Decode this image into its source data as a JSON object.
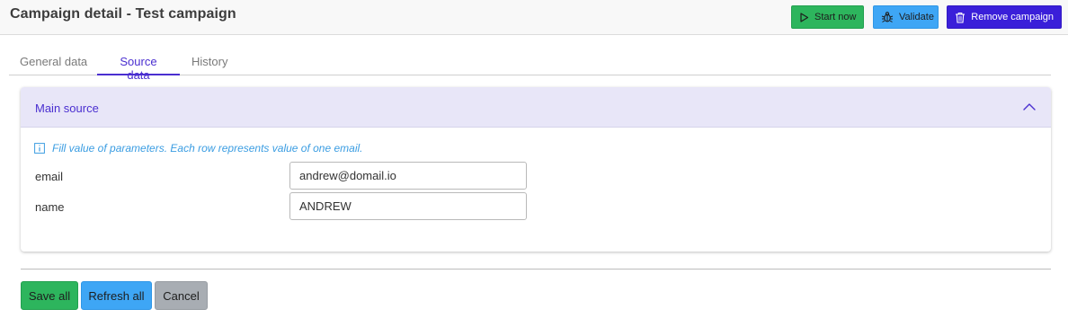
{
  "header": {
    "title": "Campaign detail - Test campaign",
    "buttons": {
      "start_label": "Start now",
      "validate_label": "Validate",
      "remove_label": "Remove campaign"
    }
  },
  "tabs": [
    {
      "label": "General data",
      "active": false
    },
    {
      "label": "Source data",
      "active": true
    },
    {
      "label": "History",
      "active": false
    }
  ],
  "card": {
    "title": "Main source",
    "expanded": true,
    "info_text": "Fill value of parameters. Each row represents value of one email.",
    "rows": [
      {
        "label": "email",
        "value": "andrew@domail.io"
      },
      {
        "label": "name",
        "value": "ANDREW"
      }
    ]
  },
  "footer": {
    "save_label": "Save all",
    "refresh_label": "Refresh all",
    "cancel_label": "Cancel"
  },
  "colors": {
    "primary": "#3a1fd9",
    "success": "#2db55d",
    "info": "#3ea6f5",
    "secondary": "#a8adb3",
    "card_header_bg": "#e8e6f8"
  },
  "icons": {
    "start": "play-icon",
    "validate": "bug-icon",
    "remove": "trash-icon",
    "collapse": "chevron-up-icon",
    "info": "info-icon"
  }
}
